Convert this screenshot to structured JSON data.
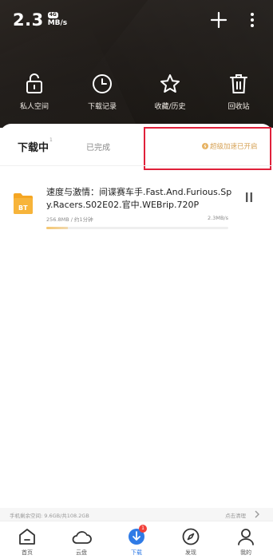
{
  "header": {
    "speed_value": "2.3",
    "speed_badge": "4G",
    "speed_unit": "MB/s",
    "icons": {
      "add": "plus-icon",
      "more": "more-vertical-icon"
    }
  },
  "quick_actions": [
    {
      "label": "私人空间",
      "icon": "lock-icon"
    },
    {
      "label": "下载记录",
      "icon": "clock-icon"
    },
    {
      "label": "收藏/历史",
      "icon": "star-icon"
    },
    {
      "label": "回收站",
      "icon": "trash-icon"
    }
  ],
  "tabs": {
    "downloading": "下载中",
    "downloading_count": "1",
    "completed": "已完成",
    "boost_status": "超级加速已开启"
  },
  "task": {
    "title": "速度与激情：间谍赛车手.Fast.And.Furious.Spy.Racers.S02E02.官中.WEBrip.720P",
    "type_badge": "BT",
    "size_eta": "256.8MB / 约1分钟",
    "speed": "2.3MB/s",
    "progress_percent": 12
  },
  "storage": {
    "info": "手机剩余空间: 9.6GB/共108.2GB",
    "action": "点击清理"
  },
  "bottom_nav": [
    {
      "label": "首页",
      "icon": "home-icon",
      "active": false
    },
    {
      "label": "云盘",
      "icon": "cloud-icon",
      "active": false
    },
    {
      "label": "下载",
      "icon": "download-icon",
      "active": true,
      "badge": "1"
    },
    {
      "label": "发现",
      "icon": "compass-icon",
      "active": false
    },
    {
      "label": "我的",
      "icon": "user-icon",
      "active": false
    }
  ],
  "colors": {
    "header_bg": "#1f1b18",
    "accent_blue": "#2f7be6",
    "boost_gold": "#d6a256",
    "highlight_red": "#e0203a",
    "bt_orange": "#f5a623"
  }
}
